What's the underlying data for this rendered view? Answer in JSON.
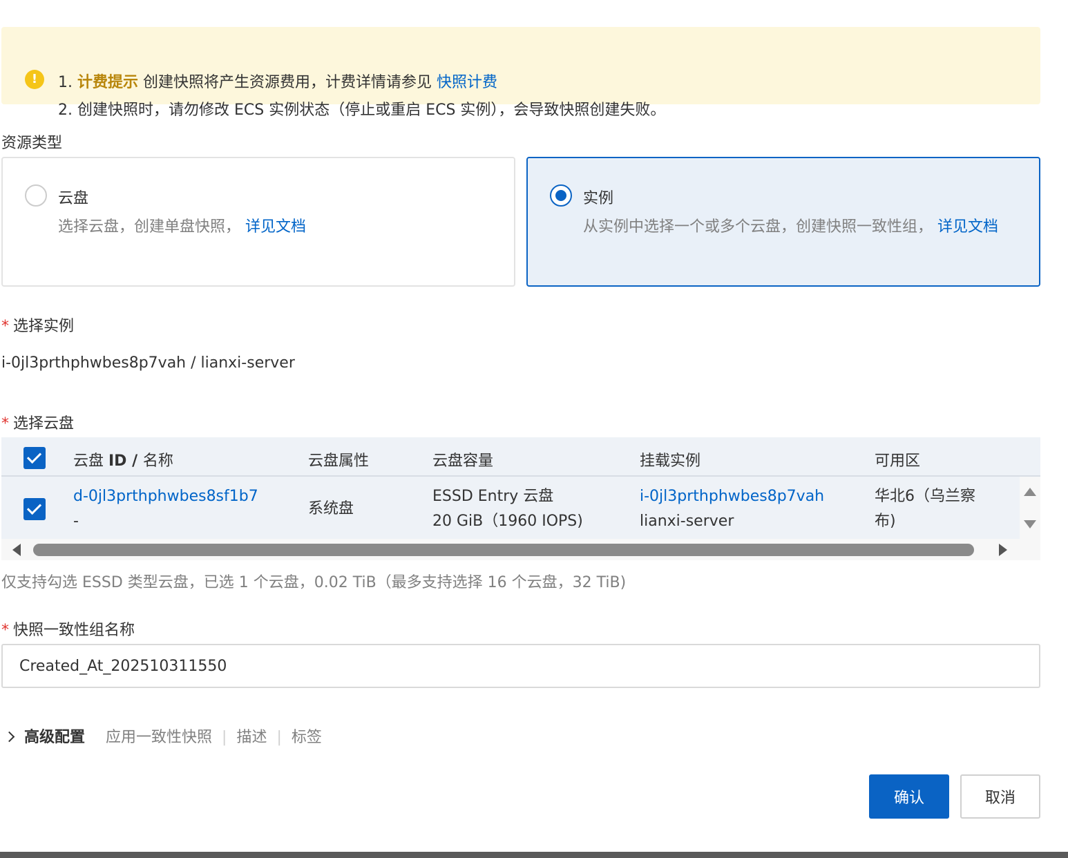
{
  "notice": {
    "line1_prefix": "1. ",
    "line1_bold": "计费提示",
    "line1_text": " 创建快照将产生资源费用，计费详情请参见 ",
    "line1_link": "快照计费",
    "line2": "2. 创建快照时，请勿修改 ECS 实例状态（停止或重启 ECS 实例），会导致快照创建失败。"
  },
  "resource_type": {
    "label": "资源类型",
    "options": [
      {
        "title": "云盘",
        "desc": "选择云盘，创建单盘快照，",
        "link": "详见文档",
        "selected": false
      },
      {
        "title": "实例",
        "desc": "从实例中选择一个或多个云盘，创建快照一致性组，",
        "link": "详见文档",
        "selected": true
      }
    ]
  },
  "select_instance": {
    "required_mark": "*",
    "label": "选择实例",
    "value": "i-0jl3prthphwbes8p7vah / lianxi-server"
  },
  "select_disk": {
    "required_mark": "*",
    "label": "选择云盘",
    "columns": {
      "id_prefix": "云盘 ",
      "id_bold": "ID / ",
      "id_suffix": "名称",
      "attr": "云盘属性",
      "capacity": "云盘容量",
      "instance": "挂载实例",
      "zone": "可用区"
    },
    "rows": [
      {
        "disk_id": "d-0jl3prthphwbes8sf1b7",
        "disk_name": "-",
        "attr": "系统盘",
        "capacity_line1": "ESSD Entry 云盘",
        "capacity_line2": "20 GiB（1960 IOPS)",
        "instance_id": "i-0jl3prthphwbes8p7vah",
        "instance_name": "lianxi-server",
        "zone_line1": "华北6（乌兰察",
        "zone_line2": "布)",
        "checked": true
      }
    ],
    "hint": "仅支持勾选 ESSD 类型云盘，已选 1 个云盘，0.02 TiB（最多支持选择 16 个云盘，32 TiB)"
  },
  "group_name": {
    "required_mark": "*",
    "label": "快照一致性组名称",
    "value": "Created_At_202510311550"
  },
  "advanced": {
    "title": "高级配置",
    "items": [
      "应用一致性快照",
      "描述",
      "标签"
    ],
    "separator": "|"
  },
  "buttons": {
    "confirm": "确认",
    "cancel": "取消"
  },
  "colors": {
    "primary": "#0a63c4",
    "link": "#0064c8",
    "notice_bg": "#fdf7dc",
    "warning": "#f5c518",
    "required": "#e0342f"
  }
}
